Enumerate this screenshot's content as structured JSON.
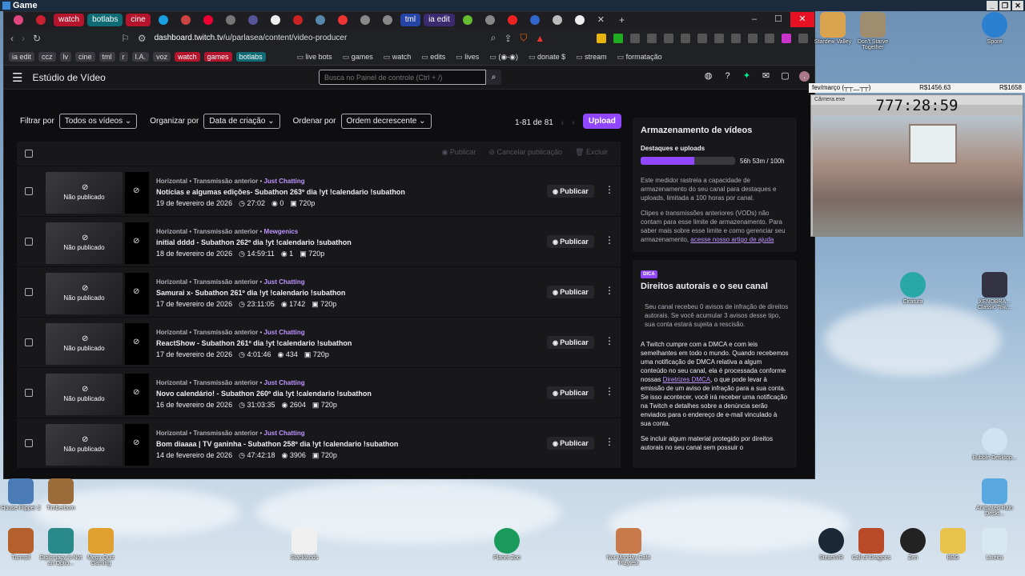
{
  "game_title": "Game",
  "tabs": [
    "watch",
    "botlabs",
    "cine",
    "tml",
    "ia edit"
  ],
  "address": {
    "host": "dashboard.twitch.tv",
    "path": "/u/parlasea/content/video-producer"
  },
  "bookmarks": [
    "ia edit",
    "ccz",
    "lv",
    "cine",
    "tml",
    "r",
    "I.A.",
    "voz",
    "watch",
    "games",
    "botlabs",
    "live bots",
    "games",
    "watch",
    "edits",
    "lives",
    "(◉-◉)",
    "donate $",
    "stream",
    "formatação"
  ],
  "header": {
    "title": "Estúdio de Vídeo",
    "search_placeholder": "Busca no Painel de controle (Ctrl + /)"
  },
  "filters": {
    "filter_label": "Filtrar por",
    "filter_value": "Todos os vídeos",
    "organize_label": "Organizar por",
    "organize_value": "Data de criação",
    "sort_label": "Ordenar por",
    "sort_value": "Ordem decrescente",
    "pager": "1-81 de 81",
    "upload": "Upload"
  },
  "bulk": {
    "publish": "Publicar",
    "cancel": "Cancelar publicação",
    "delete": "Excluir"
  },
  "videos": [
    {
      "tags": "Horizontal • Transmissão anterior • ",
      "category": "Just Chatting",
      "title": "Notícias e algumas edições- Subathon 263º dia !yt !calendario !subathon",
      "date": "19 de fevereiro de 2026",
      "duration": "27:02",
      "views": "0",
      "quality": "720p"
    },
    {
      "tags": "Horizontal • Transmissão anterior • ",
      "category": "Mewgenics",
      "title": "initial dddd - Subathon 262º dia !yt !calendario !subathon",
      "date": "18 de fevereiro de 2026",
      "duration": "14:59:11",
      "views": "1",
      "quality": "720p"
    },
    {
      "tags": "Horizontal • Transmissão anterior • ",
      "category": "Just Chatting",
      "title": "Samurai x- Subathon 261º dia !yt !calendario !subathon",
      "date": "17 de fevereiro de 2026",
      "duration": "23:11:05",
      "views": "1742",
      "quality": "720p"
    },
    {
      "tags": "Horizontal • Transmissão anterior • ",
      "category": "Just Chatting",
      "title": "ReactShow - Subathon 261º dia !yt !calendario !subathon",
      "date": "17 de fevereiro de 2026",
      "duration": "4:01:46",
      "views": "434",
      "quality": "720p"
    },
    {
      "tags": "Horizontal • Transmissão anterior • ",
      "category": "Just Chatting",
      "title": "Novo calendário! - Subathon 260º dia !yt !calendario !subathon",
      "date": "16 de fevereiro de 2026",
      "duration": "31:03:35",
      "views": "2604",
      "quality": "720p"
    },
    {
      "tags": "Horizontal • Transmissão anterior • ",
      "category": "Just Chatting",
      "title": "Bom diaaaa | TV ganinha - Subathon 258º dia !yt !calendario !subathon",
      "date": "14 de fevereiro de 2026",
      "duration": "47:42:18",
      "views": "3906",
      "quality": "720p"
    }
  ],
  "row_labels": {
    "unpublished": "Não publicado",
    "publish": "Publicar"
  },
  "storage": {
    "title": "Armazenamento de vídeos",
    "sub": "Destaques e uploads",
    "usage": "56h 53m / 100h",
    "fill_fraction": 0.5688,
    "p1": "Este medidor rastreia a capacidade de armazenamento do seu canal para destaques e uploads, limitada a 100 horas por canal.",
    "p2": "Clipes e transmissões anteriores (VODs) não contam para esse limite de armazenamento. Para saber mais sobre esse limite e como gerenciar seu armazenamento,",
    "link": "acesse nosso artigo de ajuda"
  },
  "copyright": {
    "badge": "DICA",
    "title": "Direitos autorais e o seu canal",
    "p1": "Seu canal recebeu 0 avisos de infração de direitos autorais. Se você acumular 3 avisos desse tipo, sua conta estará sujeita a rescisão.",
    "p2": "A Twitch cumpre com a DMCA e com leis semelhantes em todo o mundo. Quando recebemos uma notificação de DMCA relativa a algum conteúdo no seu canal, ela é processada conforme nossas",
    "link": "Diretrizes DMCA",
    "p2b": ", o que pode levar à emissão de um aviso de infração para a sua conta. Se isso acontecer, você irá receber uma notificação na Twitch e detalhes sobre a denúncia serão enviados para o endereço de e-mail vinculado à sua conta.",
    "p3": "Se incluir algum material protegido por direitos autorais no seu canal sem possuir o"
  },
  "overlay": {
    "goal": "fev/março (┬┬﹏┬┬)",
    "amount1": "R$1456.63",
    "amount2": "R$1658",
    "timer": "777:28:59",
    "cam_title": "Câmera.exe"
  },
  "desktop_icons": [
    "Stardew Valley",
    "Don't Starve Together",
    "Spore",
    "Ciratura",
    "XENOBRA... Classic Tow...",
    "Bubble Desktop...",
    "Animated Rain Deskt...",
    "House Flipper 2",
    "Timberborn",
    "Turmoil",
    "Diplomacy is Not an Optio...",
    "Mega Quiz Gaming",
    "Stacklands",
    "Planet Zoo",
    "Not Monday Cafe Playtest",
    "SteamVR",
    "Call of Dragons",
    "Zen",
    "BBG",
    "Lixeira"
  ]
}
